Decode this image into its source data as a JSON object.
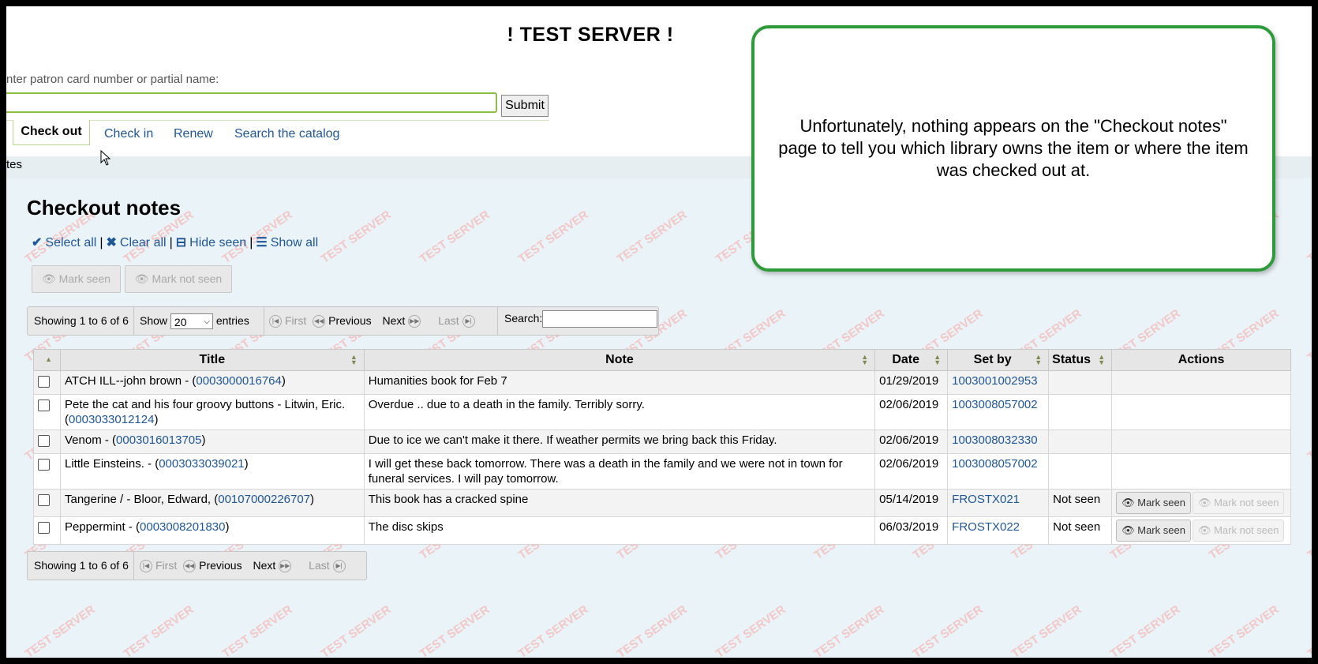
{
  "header": {
    "server_title": "! TEST SERVER !",
    "patron_label": "nter patron card number or partial name:",
    "patron_value": "",
    "submit_label": "Submit"
  },
  "tabs": {
    "checkout": "Check out",
    "checkin": "Check in",
    "renew": "Renew",
    "search_catalog": "Search the catalog"
  },
  "breadcrumb": "tes",
  "page": {
    "title": "Checkout notes",
    "select_all": "Select all",
    "clear_all": "Clear all",
    "hide_seen": "Hide seen",
    "show_all": "Show all",
    "mark_seen": "Mark seen",
    "mark_not_seen": "Mark not seen"
  },
  "pager": {
    "showing": "Showing 1 to 6 of 6",
    "show": "Show",
    "show_value": "20",
    "entries": "entries",
    "first": "First",
    "previous": "Previous",
    "next": "Next",
    "last": "Last",
    "search": "Search:"
  },
  "table": {
    "headers": {
      "title": "Title",
      "note": "Note",
      "date": "Date",
      "set_by": "Set by",
      "status": "Status",
      "actions": "Actions"
    },
    "rows": [
      {
        "title": "ATCH ILL--john brown - (",
        "barcode": "0003000016764",
        "title_end": ")",
        "note": "Humanities book for Feb 7",
        "date": "01/29/2019",
        "set_by": "1003001002953",
        "status": ""
      },
      {
        "title": "Pete the cat and his four groovy buttons - Litwin, Eric. (",
        "barcode": "0003033012124",
        "title_end": ")",
        "note": "Overdue .. due to a death in the family. Terribly sorry.",
        "date": "02/06/2019",
        "set_by": "1003008057002",
        "status": ""
      },
      {
        "title": "Venom - (",
        "barcode": "0003016013705",
        "title_end": ")",
        "note": "Due to ice we can't make it there. If weather permits we bring back this Friday.",
        "date": "02/06/2019",
        "set_by": "1003008032330",
        "status": ""
      },
      {
        "title": "Little Einsteins. - (",
        "barcode": "0003033039021",
        "title_end": ")",
        "note": "I will get these back tomorrow. There was a death in the family and we were not in town for funeral services. I will pay tomorrow.",
        "date": "02/06/2019",
        "set_by": "1003008057002",
        "status": ""
      },
      {
        "title": "Tangerine / - Bloor, Edward, (",
        "barcode": "00107000226707",
        "title_end": ")",
        "note": "This book has a cracked spine",
        "date": "05/14/2019",
        "set_by": "FROSTX021",
        "status": "Not seen"
      },
      {
        "title": "Peppermint - (",
        "barcode": "0003008201830",
        "title_end": ")",
        "note": "The disc skips",
        "date": "06/03/2019",
        "set_by": "FROSTX022",
        "status": "Not seen"
      }
    ]
  },
  "callout": "Unfortunately, nothing appears on the \"Checkout notes\" page to tell you which library owns the item or where the item was checked out at."
}
